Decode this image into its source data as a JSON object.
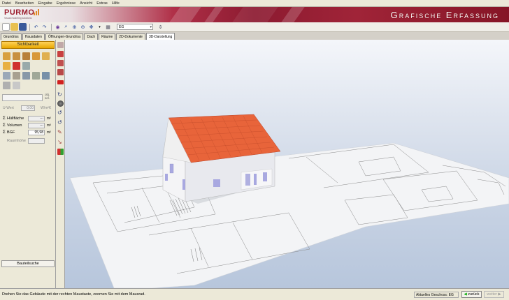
{
  "menu": [
    "Datei",
    "Bearbeiten",
    "Eingabe",
    "Ergebnisse",
    "Ansicht",
    "Extras",
    "Hilfe"
  ],
  "brand": {
    "logo": "PURMO",
    "sub": "Visual modeling solutions",
    "title": "Grafische Erfassung"
  },
  "toolbar": {
    "geschoss": "EG"
  },
  "tabs": [
    "Grundriss",
    "Hausdaten",
    "Öffnungen-Grundriss",
    "Dach",
    "Räume",
    "2D-Dokumente",
    "3D-Darstellung"
  ],
  "left": {
    "sichtbarkeit": "Sichtbarkeit",
    "obj_label": "obj. sel.",
    "uwert_label": "U-Wert",
    "uwert_value": "0,00",
    "uwert_unit": "W/m²K",
    "rows": [
      {
        "sig": "Σ",
        "label": "Hüllfläche",
        "value": "---",
        "unit": "m²"
      },
      {
        "sig": "Σ",
        "label": "Volumen",
        "value": "---",
        "unit": "m³"
      },
      {
        "sig": "Σ",
        "label": "BGF",
        "value": "95,98",
        "unit": "m²"
      },
      {
        "sig": "",
        "label": "Raumhöhe",
        "value": "",
        "unit": ""
      }
    ],
    "bauteilsuche": "Bauteilsuche"
  },
  "status": {
    "message": "Drehen Sie das Gebäude mit der rechten Maustaste, zoomen Sie mit dem Mausrad.",
    "geschoss": "Aktuelles Geschoss: EG",
    "back": "zurück",
    "next": "weiter"
  },
  "colors": {
    "accent": "#a3243a",
    "orange": "#e8a800",
    "roof": "#e8643a"
  }
}
